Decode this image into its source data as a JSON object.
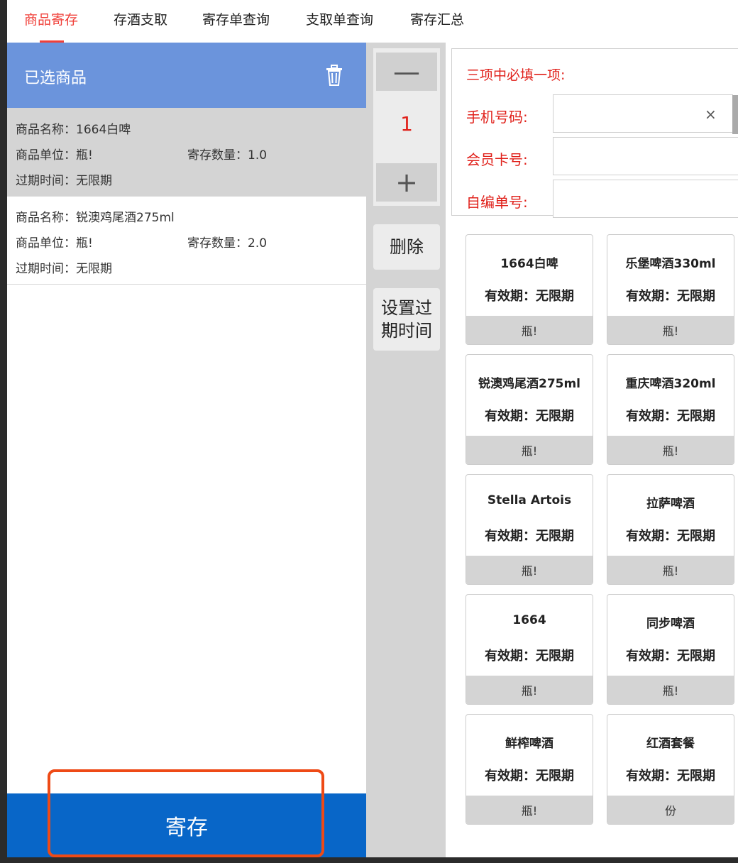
{
  "tabs": [
    "商品寄存",
    "存酒支取",
    "寄存单查询",
    "支取单查询",
    "寄存汇总"
  ],
  "left": {
    "header_title": "已选商品",
    "items": [
      {
        "name": "商品名称：1664白啤",
        "unit": "商品单位：瓶!",
        "qty": "寄存数量：1.0",
        "expiry": "过期时间：无限期"
      },
      {
        "name": "商品名称：锐澳鸡尾酒275ml",
        "unit": "商品单位：瓶!",
        "qty": "寄存数量：2.0",
        "expiry": "过期时间：无限期"
      }
    ],
    "deposit_label": "寄存"
  },
  "mid": {
    "minus": "—",
    "value": "1",
    "plus": "+",
    "delete_label": "删除",
    "set_expiry_line1": "设置过",
    "set_expiry_line2": "期时间"
  },
  "form": {
    "title": "三项中必填一项:",
    "phone_label": "手机号码:",
    "card_label": "会员卡号:",
    "serial_label": "自编单号:",
    "clear": "×"
  },
  "products": [
    {
      "name": "1664白啤",
      "expiry": "有效期：无限期",
      "unit": "瓶!"
    },
    {
      "name": "乐堡啤酒330ml",
      "expiry": "有效期：无限期",
      "unit": "瓶!"
    },
    {
      "name": "锐澳鸡尾酒275ml",
      "expiry": "有效期：无限期",
      "unit": "瓶!"
    },
    {
      "name": "重庆啤酒320ml",
      "expiry": "有效期：无限期",
      "unit": "瓶!"
    },
    {
      "name": "Stella Artois",
      "expiry": "有效期：无限期",
      "unit": "瓶!"
    },
    {
      "name": "拉萨啤酒",
      "expiry": "有效期：无限期",
      "unit": "瓶!"
    },
    {
      "name": "1664",
      "expiry": "有效期：无限期",
      "unit": "瓶!"
    },
    {
      "name": "同步啤酒",
      "expiry": "有效期：无限期",
      "unit": "瓶!"
    },
    {
      "name": "鲜榨啤酒",
      "expiry": "有效期：无限期",
      "unit": "瓶!"
    },
    {
      "name": "红酒套餐",
      "expiry": "有效期：无限期",
      "unit": "份"
    }
  ],
  "colors": {
    "accent_red": "#f0403a",
    "header_blue": "#6b94dc",
    "deposit_blue": "#0866c8",
    "highlight_orange": "#ee4a16"
  }
}
